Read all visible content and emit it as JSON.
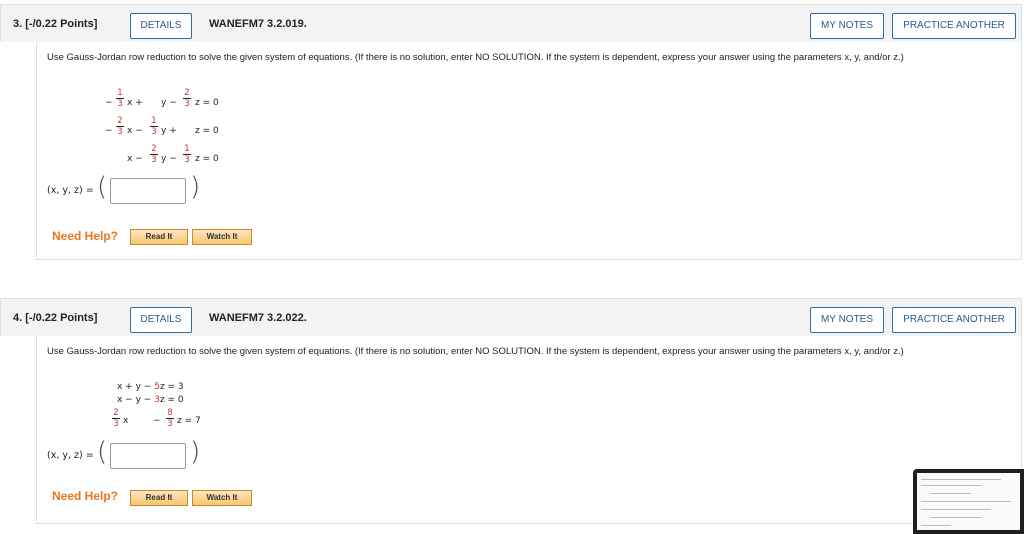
{
  "questions": [
    {
      "number": "3.",
      "points": "[-/0.22 Points]",
      "details_label": "DETAILS",
      "code": "WANEFM7 3.2.019.",
      "my_notes_label": "MY NOTES",
      "practice_label": "PRACTICE ANOTHER",
      "prompt": "Use Gauss-Jordan row reduction to solve the given system of equations. (If there is no solution, enter NO SOLUTION. If the system is dependent, express your answer using the parameters x, y, and/or z.)",
      "answer_label": "(x, y, z) =",
      "answer_value": "",
      "need_help": "Need Help?",
      "read_it": "Read It",
      "watch_it": "Watch It"
    },
    {
      "number": "4.",
      "points": "[-/0.22 Points]",
      "details_label": "DETAILS",
      "code": "WANEFM7 3.2.022.",
      "my_notes_label": "MY NOTES",
      "practice_label": "PRACTICE ANOTHER",
      "prompt": "Use Gauss-Jordan row reduction to solve the given system of equations. (If there is no solution, enter NO SOLUTION. If the system is dependent, express your answer using the parameters x, y, and/or z.)",
      "answer_label": "(x, y, z) =",
      "answer_value": "",
      "need_help": "Need Help?",
      "read_it": "Read It",
      "watch_it": "Watch It"
    }
  ],
  "q3_system": {
    "minus": "−",
    "plus": "+",
    "equals_zero": "= 0",
    "x": "x",
    "y": "y",
    "z": "z",
    "one": "1",
    "two": "2",
    "three": "3"
  },
  "q4_system": {
    "r1": "x + y −",
    "r1_coef": "5",
    "r1_tail": "z = 3",
    "r2": "x − y −",
    "r2_coef": "3",
    "r2_tail": "z = 0",
    "r3_x": "x",
    "r3_minus": "−",
    "r3_z": "z = 7",
    "two": "2",
    "eight": "8",
    "three": "3",
    "seven": "7"
  }
}
